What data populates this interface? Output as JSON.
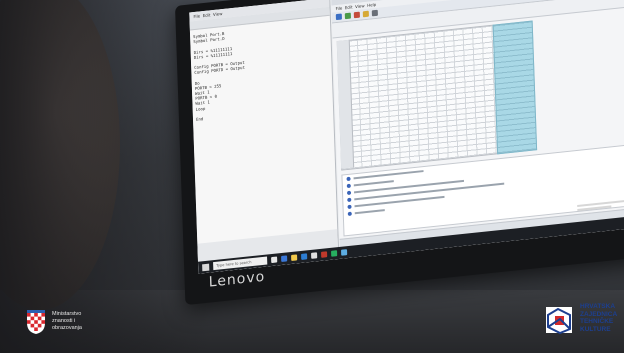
{
  "monitor": {
    "brand": "Lenovo",
    "taskbar": {
      "search_placeholder": "Type here to search"
    },
    "ide": {
      "menu": [
        "File",
        "Edit",
        "View"
      ],
      "code_lines": [
        "Symbol Port.B",
        "Symbol Port.D",
        "",
        "Dirs = %11111111",
        "Dirs = %11111111",
        "",
        "Config PORTB = Output",
        "Config PORTD = Output",
        "",
        "Do",
        "  PORTB = 255",
        "  Wait 1",
        "  PORTB = 0",
        "  Wait 1",
        "Loop",
        "",
        "End"
      ]
    },
    "programmer": {
      "menu": [
        "File",
        "Edit",
        "View",
        "Help"
      ]
    }
  },
  "logos": {
    "ministry": [
      "Ministarstvo",
      "znanosti i",
      "obrazovanja"
    ],
    "hztk": [
      "HRVATSKA",
      "ZAJEDNICA",
      "TEHNIČKE",
      "KULTURE"
    ]
  },
  "colors": {
    "ascii_highlight": "#a9d8e6",
    "hztk_blue": "#1d3f8f",
    "hztk_red": "#d22a2a",
    "croatia_red": "#d8282e"
  }
}
